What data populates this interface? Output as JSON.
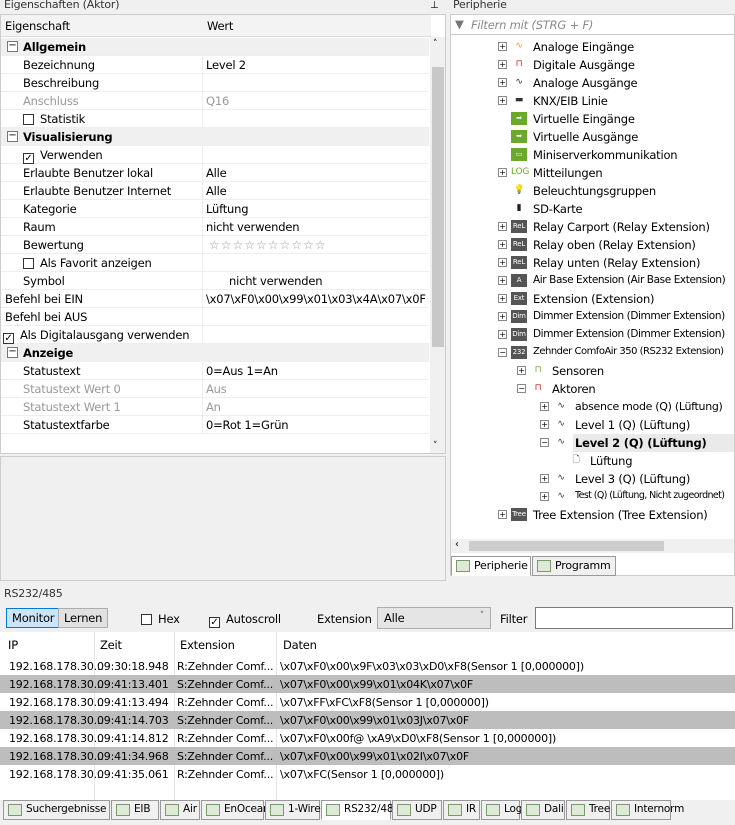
{
  "properties": {
    "title": "Eigenschaften (Aktor)",
    "col_name": "Eigenschaft",
    "col_value": "Wert",
    "rows": [
      {
        "type": "cat",
        "name": "Allgemein"
      },
      {
        "name": "Bezeichnung",
        "value": "Level 2",
        "indent": 1
      },
      {
        "name": "Beschreibung",
        "value": "",
        "indent": 1
      },
      {
        "name": "Anschluss",
        "value": "Q16",
        "indent": 1,
        "disabled": true
      },
      {
        "name": "Statistik",
        "check": false,
        "indent": 1
      },
      {
        "type": "cat",
        "name": "Visualisierung"
      },
      {
        "name": "Verwenden",
        "check": true,
        "indent": 1
      },
      {
        "name": "Erlaubte Benutzer lokal",
        "value": "Alle",
        "indent": 1
      },
      {
        "name": "Erlaubte Benutzer Internet",
        "value": "Alle",
        "indent": 1
      },
      {
        "name": "Kategorie",
        "value": "Lüftung",
        "indent": 1
      },
      {
        "name": "Raum",
        "value": "nicht verwenden",
        "indent": 1
      },
      {
        "name": "Bewertung",
        "value": "☆☆☆☆☆☆☆☆☆☆",
        "indent": 1,
        "stars": true
      },
      {
        "name": "Als Favorit anzeigen",
        "check": false,
        "indent": 1
      },
      {
        "name": "Symbol",
        "value": "nicht verwenden",
        "indent": 1,
        "symbol": true
      },
      {
        "name": "Befehl bei EIN",
        "value": "\\x07\\xF0\\x00\\x99\\x01\\x03\\x4A\\x07\\x0F",
        "indent": 0
      },
      {
        "name": "Befehl bei AUS",
        "value": "",
        "indent": 0
      },
      {
        "name": "Als Digitalausgang verwenden",
        "check": true,
        "indent": 0
      },
      {
        "type": "cat",
        "name": "Anzeige"
      },
      {
        "name": "Statustext",
        "value": "0=Aus 1=An",
        "indent": 1
      },
      {
        "name": "Statustext Wert 0",
        "value": "Aus",
        "indent": 1,
        "disabled": true
      },
      {
        "name": "Statustext Wert 1",
        "value": "An",
        "indent": 1,
        "disabled": true
      },
      {
        "name": "Statustextfarbe",
        "value": "0=Rot 1=Grün",
        "indent": 1
      }
    ]
  },
  "peripherie": {
    "title": "Peripherie",
    "filter_placeholder": "Filtern mit (STRG + F)",
    "items": [
      {
        "label": "Analoge Eingänge",
        "level": 0,
        "exp": "+",
        "icon": "analog-input-icon",
        "glyph": "∿",
        "color": "#d89a20"
      },
      {
        "label": "Digitale Ausgänge",
        "level": 0,
        "exp": "+",
        "icon": "digital-output-icon",
        "glyph": "⊓",
        "color": "#d02020"
      },
      {
        "label": "Analoge Ausgänge",
        "level": 0,
        "exp": "+",
        "icon": "analog-output-icon",
        "glyph": "∿",
        "color": "#333"
      },
      {
        "label": "KNX/EIB Linie",
        "level": 0,
        "exp": "+",
        "icon": "knx-line-icon",
        "glyph": "▬",
        "color": "#333"
      },
      {
        "label": "Virtuelle Eingänge",
        "level": 0,
        "exp": "",
        "icon": "virtual-input-icon",
        "glyph": "➡",
        "color": "#6aaa2a",
        "box": true
      },
      {
        "label": "Virtuelle Ausgänge",
        "level": 0,
        "exp": "",
        "icon": "virtual-output-icon",
        "glyph": "➡",
        "color": "#6aaa2a",
        "box": true
      },
      {
        "label": "Miniserverkommunikation",
        "level": 0,
        "exp": "",
        "icon": "network-icon",
        "glyph": "▭",
        "color": "#6aaa2a",
        "box": true
      },
      {
        "label": "Mitteilungen",
        "level": 0,
        "exp": "+",
        "icon": "log-icon",
        "glyph": "LOG",
        "color": "#6aaa2a"
      },
      {
        "label": "Beleuchtungsgruppen",
        "level": 0,
        "exp": "",
        "icon": "lighting-group-icon",
        "glyph": "💡",
        "color": "#6aaa2a"
      },
      {
        "label": "SD-Karte",
        "level": 0,
        "exp": "",
        "icon": "sd-card-icon",
        "glyph": "▮",
        "color": "#222"
      },
      {
        "label": "Relay Carport (Relay Extension)",
        "level": 0,
        "exp": "+",
        "icon": "relay-extension-icon",
        "glyph": "ReL",
        "color": "#555",
        "box": true
      },
      {
        "label": "Relay oben (Relay Extension)",
        "level": 0,
        "exp": "+",
        "icon": "relay-extension-icon",
        "glyph": "ReL",
        "color": "#555",
        "box": true
      },
      {
        "label": "Relay unten (Relay Extension)",
        "level": 0,
        "exp": "+",
        "icon": "relay-extension-icon",
        "glyph": "ReL",
        "color": "#555",
        "box": true
      },
      {
        "label": "Air Base Extension (Air Base Extension)",
        "level": 0,
        "exp": "+",
        "icon": "air-base-icon",
        "glyph": "A",
        "color": "#555",
        "box": true
      },
      {
        "label": "Extension (Extension)",
        "level": 0,
        "exp": "+",
        "icon": "extension-icon",
        "glyph": "Ext",
        "color": "#555",
        "box": true
      },
      {
        "label": "Dimmer Extension (Dimmer Extension)",
        "level": 0,
        "exp": "+",
        "icon": "dimmer-extension-icon",
        "glyph": "Dim",
        "color": "#555",
        "box": true
      },
      {
        "label": "Dimmer Extension (Dimmer Extension)",
        "level": 0,
        "exp": "+",
        "icon": "dimmer-extension-icon",
        "glyph": "Dim",
        "color": "#555",
        "box": true
      },
      {
        "label": "Zehnder ComfoAir 350 (RS232 Extension)",
        "level": 0,
        "exp": "-",
        "icon": "rs232-extension-icon",
        "glyph": "232",
        "color": "#555",
        "box": true
      },
      {
        "label": "Sensoren",
        "level": 1,
        "exp": "+",
        "icon": "sensor-icon",
        "glyph": "⊓",
        "color": "#6aaa2a"
      },
      {
        "label": "Aktoren",
        "level": 1,
        "exp": "-",
        "icon": "actor-icon",
        "glyph": "⊓",
        "color": "#d02020"
      },
      {
        "label": "absence mode (Q) (Lüftung)",
        "level": 2,
        "exp": "+",
        "icon": "analog-output-icon",
        "glyph": "∿",
        "color": "#333"
      },
      {
        "label": "Level 1 (Q) (Lüftung)",
        "level": 2,
        "exp": "+",
        "icon": "analog-output-icon",
        "glyph": "∿",
        "color": "#333"
      },
      {
        "label": "Level 2 (Q) (Lüftung)",
        "level": 2,
        "exp": "-",
        "icon": "analog-output-icon",
        "glyph": "∿",
        "color": "#333",
        "selected": true
      },
      {
        "label": "Lüftung",
        "level": 3,
        "exp": "",
        "icon": "document-icon",
        "glyph": "🗋",
        "color": "#333"
      },
      {
        "label": "Level 3 (Q) (Lüftung)",
        "level": 2,
        "exp": "+",
        "icon": "analog-output-icon",
        "glyph": "∿",
        "color": "#333"
      },
      {
        "label": "Test (Q) (Lüftung, Nicht zugeordnet)",
        "level": 2,
        "exp": "+",
        "icon": "analog-output-icon",
        "glyph": "∿",
        "color": "#333"
      },
      {
        "label": "Tree Extension (Tree Extension)",
        "level": 0,
        "exp": "+",
        "icon": "tree-extension-icon",
        "glyph": "Tree",
        "color": "#555",
        "box": true
      }
    ],
    "tabs": [
      "Peripherie",
      "Programm"
    ]
  },
  "rs232": {
    "title": "RS232/485",
    "monitor": "Monitor",
    "learn": "Lernen",
    "hex": "Hex",
    "hex_checked": false,
    "autoscroll": "Autoscroll",
    "autoscroll_checked": true,
    "extension_label": "Extension",
    "extension_value": "Alle",
    "filter_label": "Filter",
    "filter_value": "",
    "columns": [
      "IP",
      "Zeit",
      "Extension",
      "Daten"
    ],
    "rows": [
      [
        "192.168.178.30...",
        "09:30:18.948",
        "R:Zehnder Comf...",
        "\\x07\\xF0\\x00\\x9F\\x03\\x03\\xD0\\xF8(Sensor 1 [0,000000])"
      ],
      [
        "192.168.178.30...",
        "09:41:13.401",
        "S:Zehnder Comf...",
        "\\x07\\xF0\\x00\\x99\\x01\\x04K\\x07\\x0F"
      ],
      [
        "192.168.178.30...",
        "09:41:13.494",
        "R:Zehnder Comf...",
        "\\x07\\xFF\\xFC\\xF8(Sensor 1 [0,000000])"
      ],
      [
        "192.168.178.30...",
        "09:41:14.703",
        "S:Zehnder Comf...",
        "\\x07\\xF0\\x00\\x99\\x01\\x03J\\x07\\x0F"
      ],
      [
        "192.168.178.30...",
        "09:41:14.812",
        "R:Zehnder Comf...",
        "\\x07\\xF0\\x00f@ \\xA9\\xD0\\xF8(Sensor 1 [0,000000])"
      ],
      [
        "192.168.178.30...",
        "09:41:34.968",
        "S:Zehnder Comf...",
        "\\x07\\xF0\\x00\\x99\\x01\\x02I\\x07\\x0F"
      ],
      [
        "192.168.178.30...",
        "09:41:35.061",
        "R:Zehnder Comf...",
        "\\x07\\xFC(Sensor 1 [0,000000])"
      ]
    ]
  },
  "bottom_tabs": {
    "items": [
      "Suchergebnisse",
      "EIB",
      "Air",
      "EnOcean",
      "1-Wire",
      "RS232/485",
      "UDP",
      "IR",
      "Log",
      "Dali",
      "Tree",
      "Internorm"
    ],
    "active": "RS232/485"
  }
}
